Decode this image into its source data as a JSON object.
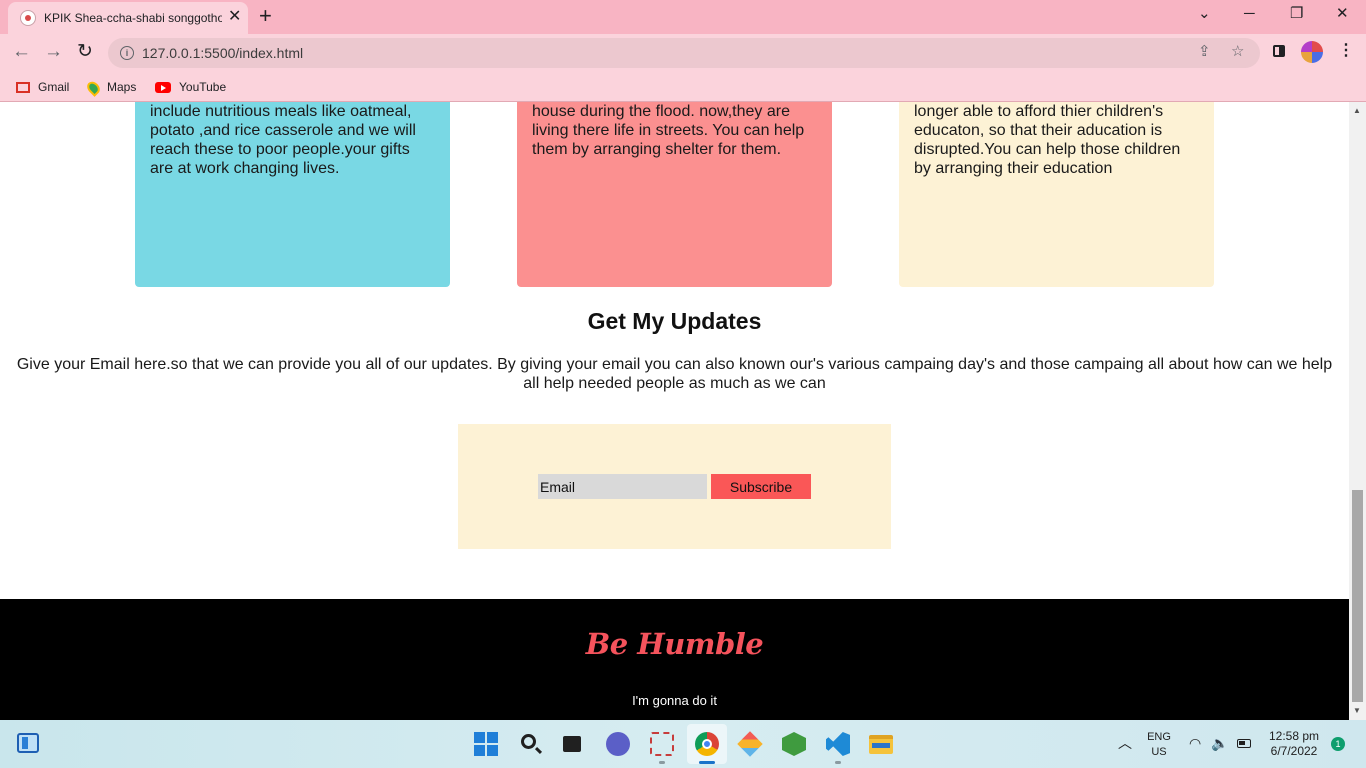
{
  "browser": {
    "tab_title": "KPIK Shea-ccha-shabi songgothon",
    "tab_close": "✕",
    "new_tab": "+",
    "window_controls": {
      "minimize": "─",
      "restore": "❐",
      "close": "✕",
      "tab_search": "⌄"
    },
    "nav": {
      "back": "←",
      "forward": "→",
      "reload": "↻"
    },
    "url": "127.0.0.1:5500/index.html",
    "omnibox_icons": {
      "share": "⇪",
      "bookmark_star": "☆"
    },
    "menu": "⋮",
    "bookmarks": [
      {
        "label": "Gmail",
        "icon": "gmail-icon"
      },
      {
        "label": "Maps",
        "icon": "maps-icon"
      },
      {
        "label": "YouTube",
        "icon": "youtube-icon"
      }
    ]
  },
  "cards": [
    {
      "text": "include nutritious meals like oatmeal, potato ,and rice casserole and we will reach these to poor people.your gifts are at work changing lives.",
      "color": "#79d8e4"
    },
    {
      "text": "house during the flood. now,they are living there life in streets. You can help them by arranging shelter for them.",
      "color": "#fb9090"
    },
    {
      "text": "longer able to afford thier children's educaton, so that their aducation is disrupted.You can help those children by arranging their education",
      "color": "#fdf2d5"
    }
  ],
  "updates": {
    "title": "Get My Updates",
    "description": "Give your Email here.so that we can provide you all of our updates. By giving your email you can also known our's various campaing day's and those campaing all about how can we help all help needed people as much as we can",
    "email_placeholder": "Email",
    "subscribe_label": "Subscribe"
  },
  "footer": {
    "brand": "Be Humble",
    "tagline": "I'm gonna do it"
  },
  "taskbar": {
    "language": "ENG",
    "region": "US",
    "time": "12:58 pm",
    "date": "6/7/2022",
    "notifications": "1",
    "tray_chevron": "︿",
    "wifi": "◠",
    "volume": "🔈"
  },
  "colors": {
    "chrome_tabbar": "#f8b4c3",
    "chrome_toolbar": "#fbd3dc",
    "subscribe_button": "#fa5757",
    "footer_brand": "#f5535c",
    "footer_bg": "#000000"
  }
}
